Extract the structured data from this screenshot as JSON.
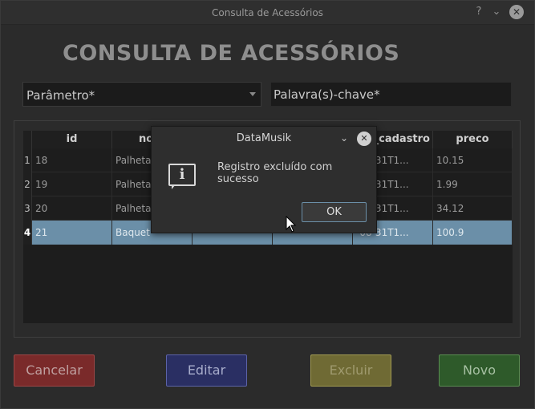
{
  "window": {
    "title": "Consulta de Acessórios",
    "help_icon": "question-icon",
    "minimize_icon": "chevron-down-icon",
    "close_icon": "close-icon"
  },
  "page_title": "CONSULTA DE ACESSÓRIOS",
  "search": {
    "parameter_value": "Parâmetro*",
    "keyword_value": "Palavra(s)-chave*"
  },
  "table": {
    "columns": [
      "id",
      "no",
      "",
      "",
      "_cadastro",
      "preco"
    ],
    "rows": [
      {
        "num": "1",
        "id": "18",
        "nome": "Palheta",
        "c3": "",
        "c4": "",
        "data": "-08-31T1...",
        "preco": "10.15"
      },
      {
        "num": "2",
        "id": "19",
        "nome": "Palheta",
        "c3": "",
        "c4": "",
        "data": "-08-31T1...",
        "preco": "1.99"
      },
      {
        "num": "3",
        "id": "20",
        "nome": "Palheta",
        "c3": "",
        "c4": "",
        "data": "-08-31T1...",
        "preco": "34.12"
      },
      {
        "num": "4",
        "id": "21",
        "nome": "Baquet",
        "c3": "",
        "c4": "",
        "data": "-08-31T1...",
        "preco": "100.9"
      }
    ],
    "selected_row": 4
  },
  "buttons": {
    "cancel": "Cancelar",
    "edit": "Editar",
    "delete": "Excluir",
    "new": "Novo"
  },
  "dialog": {
    "title": "DataMusik",
    "message": "Registro excluído com sucesso",
    "ok_label": "OK",
    "icon": "info-icon"
  },
  "colors": {
    "selected_row": "#6b8fa8",
    "cancel": "#7a2a2a",
    "edit": "#2a2f63",
    "delete": "#6f6a34",
    "new": "#2e5a2a"
  }
}
